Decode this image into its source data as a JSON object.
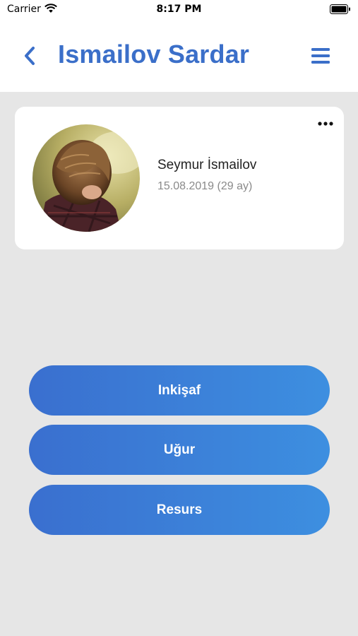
{
  "status_bar": {
    "carrier": "Carrier",
    "time": "8:17 PM",
    "icons": [
      "wifi-icon",
      "battery-icon"
    ]
  },
  "header": {
    "title": "Ismailov Sardar",
    "back_icon": "chevron-left-icon",
    "menu_icon": "hamburger-menu-icon",
    "accent_color": "#3b6fc9"
  },
  "profile": {
    "name": "Seymur İsmailov",
    "birth": "15.08.2019 (29 ay)",
    "menu_icon": "more-horizontal-icon"
  },
  "actions": [
    {
      "label": "Inkişaf"
    },
    {
      "label": "Uğur"
    },
    {
      "label": "Resurs"
    }
  ],
  "colors": {
    "background": "#e6e6e6",
    "button_start": "#3a6fcf",
    "button_end": "#3d8fe0"
  }
}
